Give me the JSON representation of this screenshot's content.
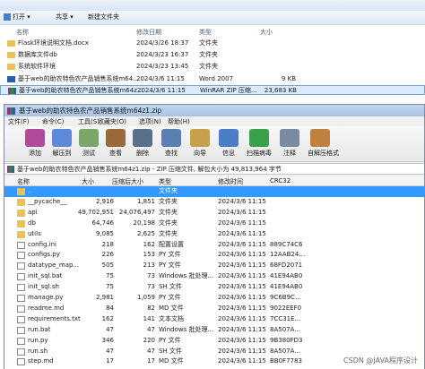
{
  "explorer": {
    "toolbar": {
      "open_label": "打开",
      "share_label": "共享",
      "new_folder_label": "新建文件夹"
    },
    "columns": {
      "name": "名称",
      "date": "修改日期",
      "type": "类型",
      "size": "大小"
    },
    "files": [
      {
        "name": "Flask环境说明文档.docx",
        "date": "2024/3/26 18:37",
        "type": "文件夹",
        "size": "",
        "icon": "folder-icon"
      },
      {
        "name": "数据库文件db",
        "date": "2024/3/23 16:37",
        "type": "文件夹",
        "size": "",
        "icon": "folder-icon"
      },
      {
        "name": "系统软件环境",
        "date": "2024/3/23 13:45",
        "type": "文件夹",
        "size": "",
        "icon": "folder-icon"
      },
      {
        "name": "基于web的助农特色农产品销售系统m64...",
        "date": "2024/3/6 11:15",
        "type": "Word 2007",
        "size": "9 KB",
        "icon": "word-icon"
      },
      {
        "name": "基于web的助农特色农产品销售系统m64z...",
        "date": "2024/3/6 11:15",
        "type": "WinRAR ZIP 压缩...",
        "size": "23,683 KB",
        "icon": "rar-icon"
      }
    ]
  },
  "winrar": {
    "title": "基于web的助农特色农产品销售系统m64z1.zip",
    "menu": [
      "文件(F)",
      "命令(C)",
      "工具(S)",
      "收藏夹(O)",
      "选项(N)",
      "帮助(H)"
    ],
    "tools": [
      {
        "label": "添加",
        "color": "#b04a9a"
      },
      {
        "label": "解压到",
        "color": "#5c8ad8"
      },
      {
        "label": "测试",
        "color": "#7aa66a"
      },
      {
        "label": "查看",
        "color": "#9a6a3a"
      },
      {
        "label": "删除",
        "color": "#5a6f8a"
      },
      {
        "label": "查找",
        "color": "#5a7fb0"
      },
      {
        "label": "向导",
        "color": "#c8a04a"
      },
      {
        "label": "信息",
        "color": "#4a7fc8"
      },
      {
        "label": "扫描病毒",
        "color": "#3aa04a"
      },
      {
        "label": "注释",
        "color": "#7a8aa0"
      },
      {
        "label": "自解压格式",
        "color": "#c08040"
      }
    ],
    "path": "基于web的助农特色农产品销售系统m64z1.zip - ZIP 压缩文件, 解包大小为 49,813,964 字节",
    "columns": {
      "name": "名称",
      "size": "大小",
      "packed": "压缩后大小",
      "type": "类型",
      "modified": "修改时间",
      "crc": "CRC32"
    },
    "rows": [
      {
        "name": "..",
        "size": "",
        "packed": "",
        "type": "文件夹",
        "modified": "",
        "crc": "",
        "folder": true
      },
      {
        "name": "__pycache__",
        "size": "2,916",
        "packed": "1,851",
        "type": "文件夹",
        "modified": "2024/3/6 11:15",
        "crc": "",
        "folder": true
      },
      {
        "name": "api",
        "size": "49,702,951",
        "packed": "24,076,497",
        "type": "文件夹",
        "modified": "2024/3/6 11:15",
        "crc": "",
        "folder": true
      },
      {
        "name": "db",
        "size": "64,746",
        "packed": "20,198",
        "type": "文件夹",
        "modified": "2024/3/6 11:15",
        "crc": "",
        "folder": true
      },
      {
        "name": "utils",
        "size": "9,085",
        "packed": "2,625",
        "type": "文件夹",
        "modified": "2024/3/6 11:15",
        "crc": "",
        "folder": true
      },
      {
        "name": "config.ini",
        "size": "218",
        "packed": "162",
        "type": "配置设置",
        "modified": "2024/3/6 11:15",
        "crc": "889C74C6",
        "folder": false
      },
      {
        "name": "configs.py",
        "size": "226",
        "packed": "153",
        "type": "PY 文件",
        "modified": "2024/3/6 11:15",
        "crc": "12AAB24...",
        "folder": false
      },
      {
        "name": "datatype_map...",
        "size": "505",
        "packed": "213",
        "type": "PY 文件",
        "modified": "2024/3/6 11:15",
        "crc": "68FD2071",
        "folder": false
      },
      {
        "name": "init_sql.bat",
        "size": "75",
        "packed": "73",
        "type": "Windows 批处理...",
        "modified": "2024/3/6 11:15",
        "crc": "41E94AB0",
        "folder": false
      },
      {
        "name": "init_sql.sh",
        "size": "75",
        "packed": "73",
        "type": "SH 文件",
        "modified": "2024/3/6 11:15",
        "crc": "41E94AB0",
        "folder": false
      },
      {
        "name": "manage.py",
        "size": "2,981",
        "packed": "1,059",
        "type": "PY 文件",
        "modified": "2024/3/6 11:15",
        "crc": "9C6B9C...",
        "folder": false
      },
      {
        "name": "readme.md",
        "size": "84",
        "packed": "82",
        "type": "MD 文件",
        "modified": "2024/3/6 11:15",
        "crc": "9022EEF0",
        "folder": false
      },
      {
        "name": "requirements.txt",
        "size": "162",
        "packed": "141",
        "type": "文本文档",
        "modified": "2024/3/6 11:15",
        "crc": "7CC31E...",
        "folder": false
      },
      {
        "name": "run.bat",
        "size": "47",
        "packed": "47",
        "type": "Windows 批处理...",
        "modified": "2024/3/6 11:15",
        "crc": "8A507A...",
        "folder": false
      },
      {
        "name": "run.py",
        "size": "346",
        "packed": "220",
        "type": "PY 文件",
        "modified": "2024/3/6 11:15",
        "crc": "9B380FD3",
        "folder": false
      },
      {
        "name": "run.sh",
        "size": "47",
        "packed": "47",
        "type": "SH 文件",
        "modified": "2024/3/6 11:15",
        "crc": "8A507A...",
        "folder": false
      },
      {
        "name": "step.md",
        "size": "17",
        "packed": "17",
        "type": "MD 文件",
        "modified": "2024/3/6 11:15",
        "crc": "BB0F7783",
        "folder": false
      }
    ]
  },
  "watermark": "CSDN @JAVA程序设计"
}
